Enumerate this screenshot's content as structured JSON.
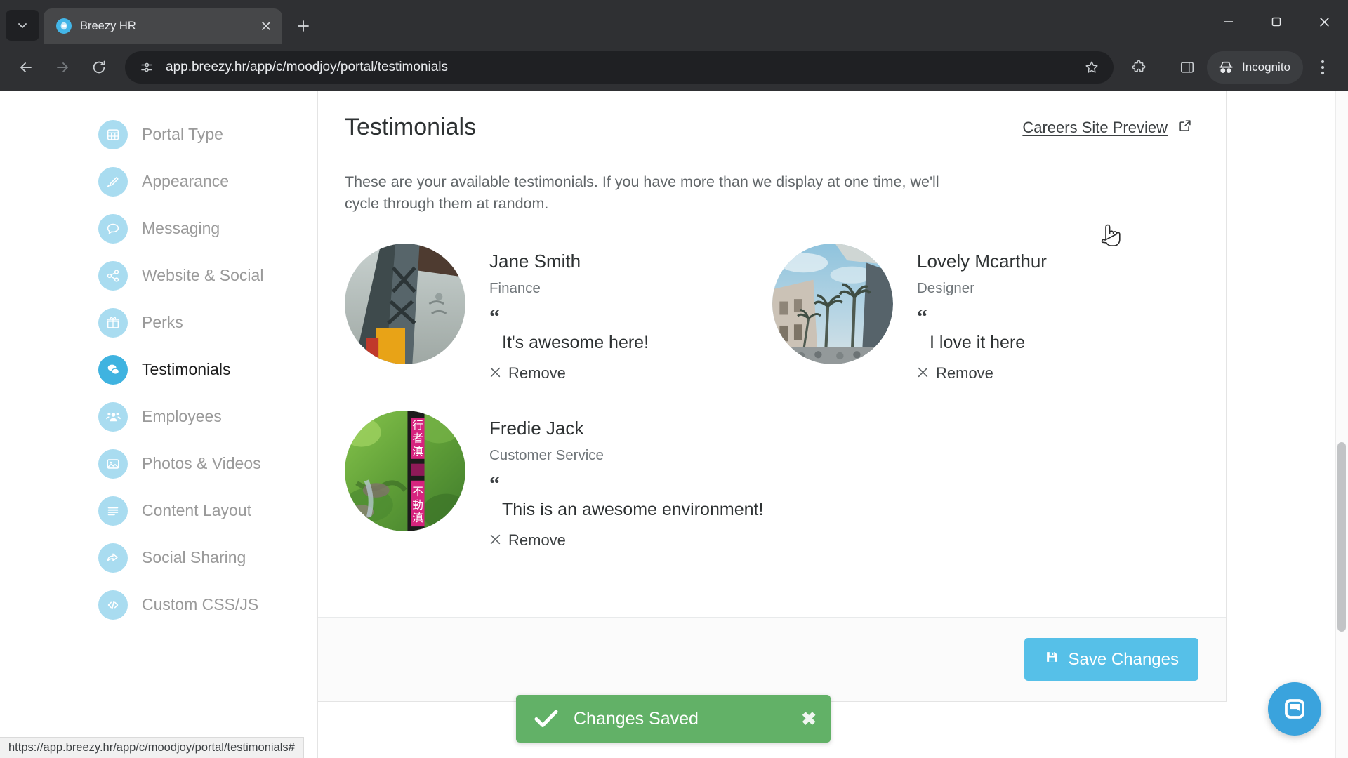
{
  "browser": {
    "tab": {
      "title": "Breezy HR",
      "favicon": "cloud-icon"
    },
    "new_tab_label": "+",
    "url": "app.breezy.hr/app/c/moodjoy/portal/testimonials",
    "profile_label": "Incognito",
    "status_url": "https://app.breezy.hr/app/c/moodjoy/portal/testimonials#"
  },
  "sidebar": {
    "items": [
      {
        "label": "Portal Type",
        "icon": "grid-icon",
        "active": false
      },
      {
        "label": "Appearance",
        "icon": "paintbrush-icon",
        "active": false
      },
      {
        "label": "Messaging",
        "icon": "chat-bubble-icon",
        "active": false
      },
      {
        "label": "Website & Social",
        "icon": "share-icon",
        "active": false
      },
      {
        "label": "Perks",
        "icon": "gift-icon",
        "active": false
      },
      {
        "label": "Testimonials",
        "icon": "testimonial-icon",
        "active": true
      },
      {
        "label": "Employees",
        "icon": "people-icon",
        "active": false
      },
      {
        "label": "Photos & Videos",
        "icon": "image-icon",
        "active": false
      },
      {
        "label": "Content Layout",
        "icon": "list-icon",
        "active": false
      },
      {
        "label": "Social Sharing",
        "icon": "share-arrow-icon",
        "active": false
      },
      {
        "label": "Custom CSS/JS",
        "icon": "code-icon",
        "active": false
      }
    ]
  },
  "main": {
    "title": "Testimonials",
    "preview_link": "Careers Site Preview",
    "intro": "These are your available testimonials. If you have more than we display at one time, we'll cycle through them at random.",
    "remove_label": "Remove",
    "quote_mark": "“",
    "testimonials": [
      {
        "name": "Jane Smith",
        "role": "Finance",
        "quote": "It's awesome here!",
        "avatar": "tower-photo"
      },
      {
        "name": "Lovely Mcarthur",
        "role": "Designer",
        "quote": "I love it here",
        "avatar": "city-photo"
      },
      {
        "name": "Fredie Jack",
        "role": "Customer Service",
        "quote": "This is an awesome environment!",
        "avatar": "forest-photo"
      }
    ],
    "save_label": "Save Changes"
  },
  "toast": {
    "message": "Changes Saved",
    "close_label": "✖",
    "color": "#62b167"
  },
  "colors": {
    "accent": "#56c0e8",
    "sidebar_icon": "#a9dcf0",
    "sidebar_icon_active": "#3fb3e0",
    "success": "#62b167",
    "chat_bubble": "#3aa3dd"
  }
}
